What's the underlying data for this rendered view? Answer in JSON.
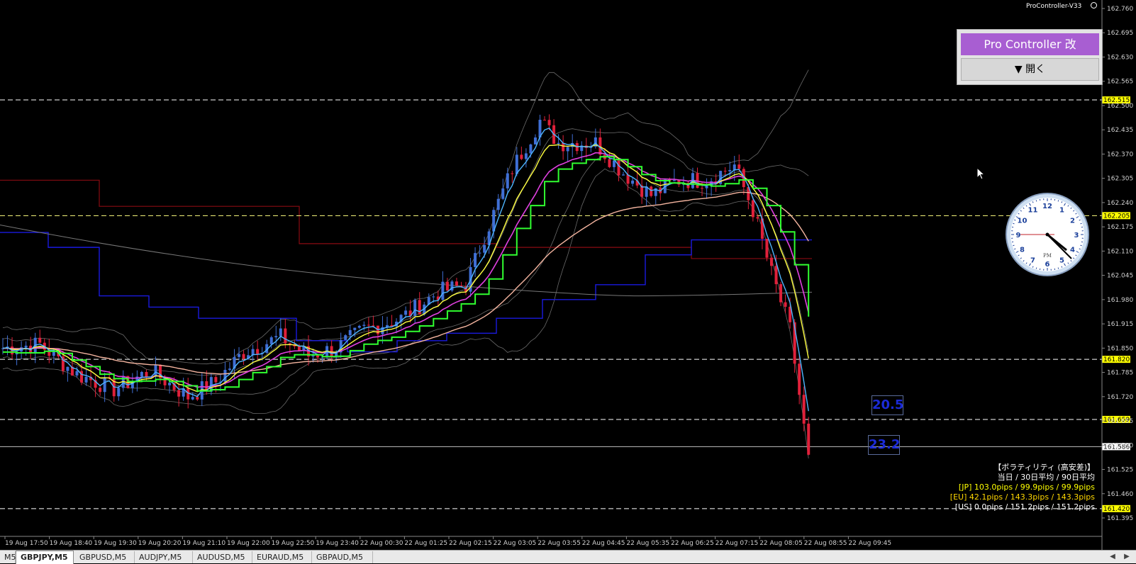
{
  "indicator": {
    "version_label": "ProController-V33",
    "panel_title": "Pro Controller 改",
    "open_button": "▼ 開く"
  },
  "price_axis": {
    "ticks": [
      "162.760",
      "162.695",
      "162.630",
      "162.565",
      "162.500",
      "162.435",
      "162.370",
      "162.305",
      "162.240",
      "162.175",
      "162.110",
      "162.045",
      "161.980",
      "161.915",
      "161.850",
      "161.785",
      "161.720",
      "161.655",
      "161.590",
      "161.525",
      "161.460",
      "161.395"
    ],
    "levels": [
      {
        "label": "162.515",
        "value": 162.515,
        "color": "#ffff00",
        "line": "#ffffff"
      },
      {
        "label": "162.205",
        "value": 162.205,
        "color": "#ffff00",
        "line": "#ffff80"
      },
      {
        "label": "161.820",
        "value": 161.82,
        "color": "#ffff00",
        "line": "#ffffff"
      },
      {
        "label": "161.659",
        "value": 161.659,
        "color": "#ffff00",
        "line": "#ffffff"
      },
      {
        "label": "161.586",
        "value": 161.586,
        "color": "#ffffff",
        "line": "#c0c0c0"
      },
      {
        "label": "161.420",
        "value": 161.42,
        "color": "#ffff00",
        "line": "#ffffff"
      }
    ],
    "range": [
      161.378,
      162.775
    ]
  },
  "time_axis": {
    "ticks": [
      "19 Aug 17:50",
      "19 Aug 18:40",
      "19 Aug 19:30",
      "19 Aug 20:20",
      "19 Aug 21:10",
      "19 Aug 22:00",
      "19 Aug 22:50",
      "19 Aug 23:40",
      "22 Aug 00:30",
      "22 Aug 01:25",
      "22 Aug 02:15",
      "22 Aug 03:05",
      "22 Aug 03:55",
      "22 Aug 04:45",
      "22 Aug 05:35",
      "22 Aug 06:25",
      "22 Aug 07:15",
      "22 Aug 08:05",
      "22 Aug 08:55",
      "22 Aug 09:45"
    ]
  },
  "pip_boxes": [
    {
      "value": "20.5"
    },
    {
      "value": "23.2"
    }
  ],
  "volatility": {
    "title": "【ボラティリティ (高安差)】",
    "header": "当日 / 30日平均 / 90日平均",
    "rows": [
      {
        "text": "[JP] 103.0pips / 99.9pips / 99.9pips",
        "color": "#ffff00"
      },
      {
        "text": "[EU] 42.1pips / 143.3pips / 143.3pips",
        "color": "#ffd700"
      },
      {
        "text": "[US] 0.0pips / 151.2pips / 151.2pips",
        "color": "#ffffff"
      }
    ]
  },
  "clock": {
    "numbers": [
      "12",
      "1",
      "2",
      "3",
      "4",
      "5",
      "6",
      "7",
      "8",
      "9",
      "10",
      "11"
    ],
    "label": "PM"
  },
  "tabs": [
    {
      "label": "M5"
    },
    {
      "label": "GBPJPY,M5",
      "active": true
    },
    {
      "label": "GBPUSD,M5"
    },
    {
      "label": "AUDJPY,M5"
    },
    {
      "label": "AUDUSD,M5"
    },
    {
      "label": "EURAUD,M5"
    },
    {
      "label": "GBPAUD,M5"
    }
  ],
  "colors": {
    "bull": "#3f6fd6",
    "bear": "#e0203a",
    "ma_fast": "#4fb6ff",
    "ma_yellow": "#ffff40",
    "ma_magenta": "#e040e0",
    "ma_green": "#30ff30",
    "ma_salmon": "#f5b5a0",
    "step_blue": "#1a1adf",
    "step_darkred": "#8a0b12",
    "bands": "#5a5a5a"
  }
}
